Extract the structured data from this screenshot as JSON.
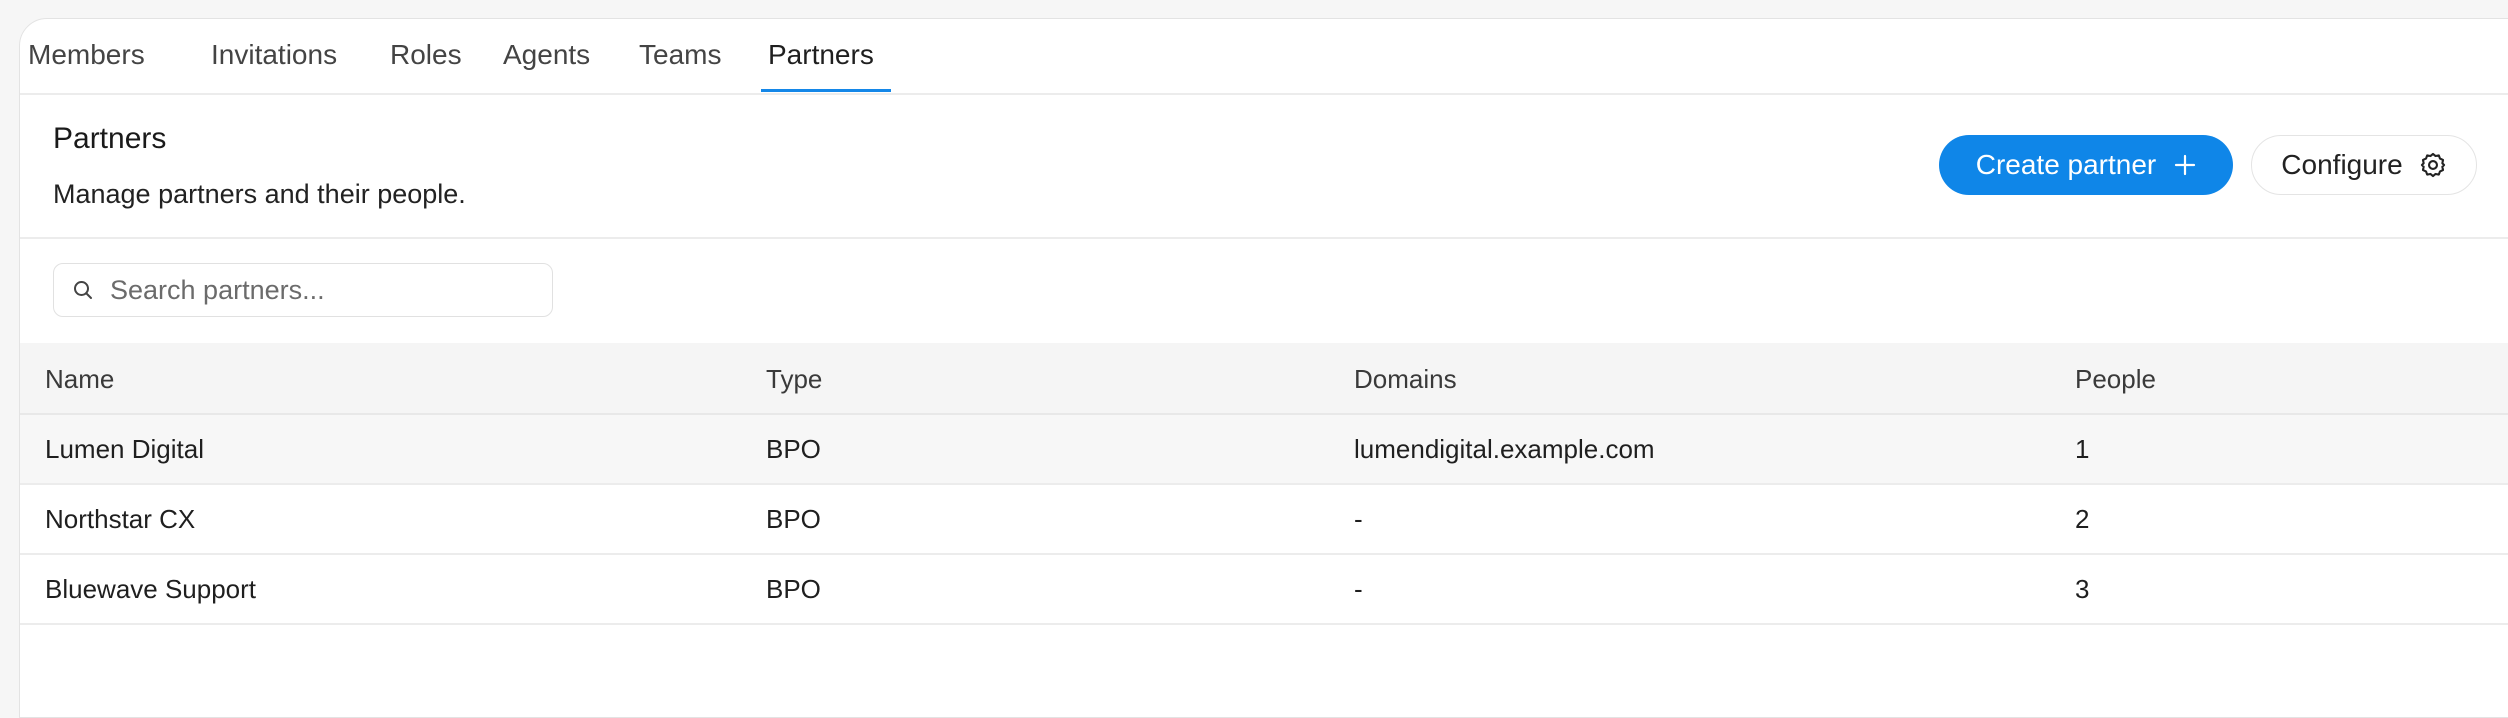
{
  "tabs": [
    {
      "label": "Members"
    },
    {
      "label": "Invitations"
    },
    {
      "label": "Roles"
    },
    {
      "label": "Agents"
    },
    {
      "label": "Teams"
    },
    {
      "label": "Partners",
      "active": true
    }
  ],
  "header": {
    "title": "Partners",
    "subtitle": "Manage partners and their people."
  },
  "actions": {
    "create_label": "Create partner",
    "create_icon": "plus-icon",
    "configure_label": "Configure",
    "configure_icon": "gear-icon"
  },
  "search": {
    "placeholder": "Search partners...",
    "value": "",
    "icon": "search-icon"
  },
  "table": {
    "columns": [
      "Name",
      "Type",
      "Domains",
      "People"
    ],
    "rows": [
      {
        "name": "Lumen Digital",
        "type": "BPO",
        "domains": "lumendigital.example.com",
        "people": "1"
      },
      {
        "name": "Northstar CX",
        "type": "BPO",
        "domains": "-",
        "people": "2"
      },
      {
        "name": "Bluewave Support",
        "type": "BPO",
        "domains": "-",
        "people": "3"
      }
    ]
  },
  "colors": {
    "accent": "#0f86e8",
    "tab_underline": "#1487e8",
    "header_bg": "#f5f5f5"
  }
}
